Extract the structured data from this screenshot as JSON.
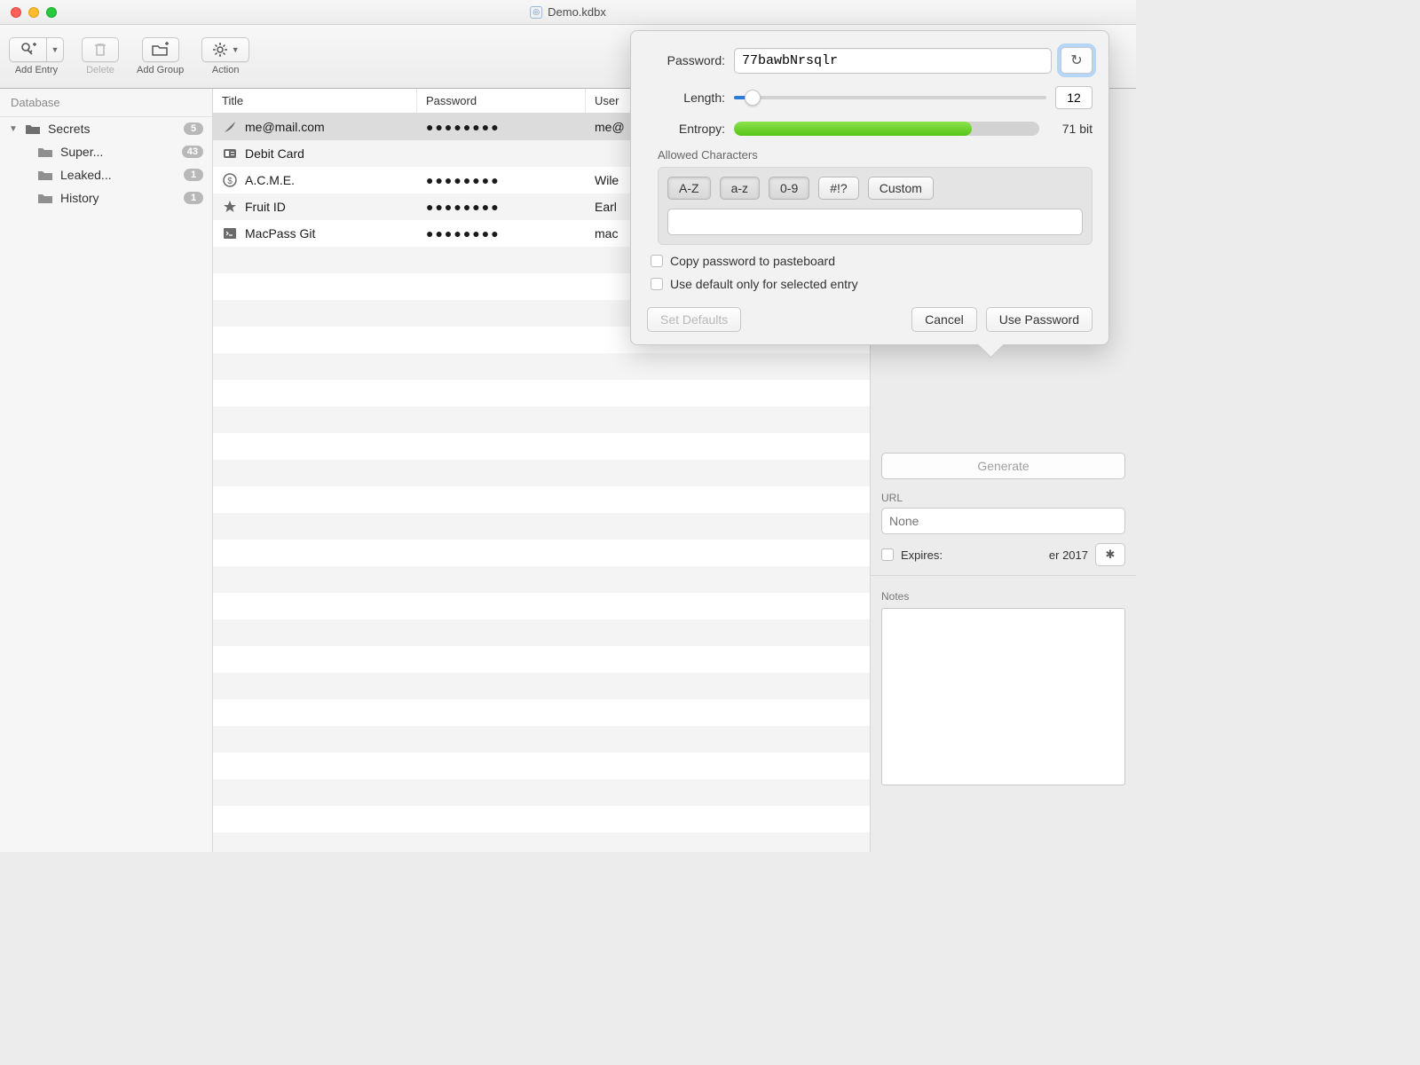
{
  "window": {
    "title": "Demo.kdbx"
  },
  "toolbar": {
    "addEntry": "Add Entry",
    "delete": "Delete",
    "addGroup": "Add Group",
    "action": "Action"
  },
  "sidebar": {
    "header": "Database",
    "root": {
      "label": "Secrets",
      "count": "5"
    },
    "children": [
      {
        "label": "Super...",
        "count": "43"
      },
      {
        "label": "Leaked...",
        "count": "1"
      },
      {
        "label": "History",
        "count": "1"
      }
    ]
  },
  "columns": {
    "title": "Title",
    "password": "Password",
    "username": "User"
  },
  "entries": [
    {
      "icon": "feather",
      "title": "me@mail.com",
      "password": "●●●●●●●●",
      "user": "me@",
      "selected": true
    },
    {
      "icon": "idcard",
      "title": "Debit Card",
      "password": "",
      "user": ""
    },
    {
      "icon": "dollar",
      "title": "A.C.M.E.",
      "password": "●●●●●●●●",
      "user": "Wile"
    },
    {
      "icon": "star",
      "title": "Fruit ID",
      "password": "●●●●●●●●",
      "user": "Earl"
    },
    {
      "icon": "terminal",
      "title": "MacPass Git",
      "password": "●●●●●●●●",
      "user": "mac"
    }
  ],
  "popover": {
    "passwordLabel": "Password:",
    "passwordValue": "77bawbNrsqlr",
    "lengthLabel": "Length:",
    "lengthValue": "12",
    "sliderPercent": 6,
    "entropyLabel": "Entropy:",
    "entropyPercent": 78,
    "entropyText": "71 bit",
    "allowedLabel": "Allowed Characters",
    "charClasses": [
      "A-Z",
      "a-z",
      "0-9",
      "#!?",
      "Custom"
    ],
    "copyLabel": "Copy password to pasteboard",
    "defaultLabel": "Use default only for selected entry",
    "setDefaults": "Set Defaults",
    "cancel": "Cancel",
    "usePassword": "Use Password"
  },
  "rightPanel": {
    "generate": "Generate",
    "urlLabel": "URL",
    "urlPlaceholder": "None",
    "expiresLabel": "Expires:",
    "expiresValue": "er 2017",
    "notesLabel": "Notes"
  }
}
